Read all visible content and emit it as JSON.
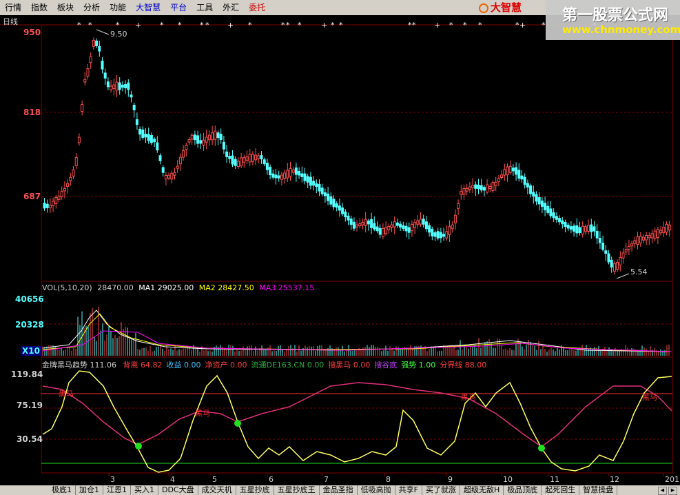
{
  "menu": {
    "items": [
      {
        "label": "行情",
        "color": "normal"
      },
      {
        "label": "指数",
        "color": "normal"
      },
      {
        "label": "板块",
        "color": "normal"
      },
      {
        "label": "分析",
        "color": "normal"
      },
      {
        "label": "功能",
        "color": "normal"
      },
      {
        "label": "大智慧",
        "color": "blue"
      },
      {
        "label": "平台",
        "color": "blue"
      },
      {
        "label": "工具",
        "color": "normal"
      },
      {
        "label": "外汇",
        "color": "normal"
      },
      {
        "label": "委托",
        "color": "red"
      }
    ],
    "logo": "大智慧"
  },
  "watermark": {
    "line1": "第一股票公式网",
    "line2": "www.chnmoney.com"
  },
  "chart": {
    "period": "日线",
    "price_axis": [
      "950",
      "818",
      "687"
    ],
    "high_label": "9.50",
    "low_label": "5.54",
    "vol_axis": [
      "40656",
      "20328"
    ],
    "vol_multiplier": "X10",
    "ind_axis": [
      "119.84",
      "75.19",
      "30.54"
    ],
    "month_labels": [
      "3",
      "4",
      "5",
      "6",
      "7",
      "8",
      "9",
      "10",
      "11",
      "12",
      "201"
    ]
  },
  "volume": {
    "name": "VOL",
    "params": "(5,10,20)",
    "value": "28470.00",
    "ma1_label": "MA1",
    "ma1": "29025.00",
    "ma2_label": "MA2",
    "ma2": "28427.50",
    "ma3_label": "MA3",
    "ma3": "25537.15"
  },
  "indicator": {
    "name": "金牌黑马趋势",
    "value": "111.06",
    "items": [
      {
        "label": "背离",
        "value": "64.82",
        "color": "#ff4040"
      },
      {
        "label": "收益",
        "value": "0.00",
        "color": "#40c0ff"
      },
      {
        "label": "净资产",
        "value": "0.00",
        "color": "#ff4040"
      },
      {
        "label": "流通DE163.CN",
        "value": "0.00",
        "color": "#20b040"
      },
      {
        "label": "搜黑马",
        "value": "0.00",
        "color": "#ff4040"
      },
      {
        "label": "搜谷底",
        "value": "",
        "color": "#c040ff"
      },
      {
        "label": "强势",
        "value": "1.00",
        "color": "#40ff40"
      },
      {
        "label": "分界线",
        "value": "88.00",
        "color": "#ff4040"
      }
    ],
    "horse_label": "黑马"
  },
  "tabs": [
    "极底1",
    "加仓1",
    "江恩1",
    "买入1",
    "DDC大盘",
    "成交天机",
    "五星抄底",
    "五星抄底王",
    "金品圣指",
    "低吸高抛",
    "共享F",
    "买了就涨",
    "超级无敌H",
    "极品顶底",
    "起死回生",
    "智慧操盘"
  ],
  "colors": {
    "up": "#ff5050",
    "down": "#54ffff",
    "grid": "#800000",
    "ma1": "#ffffff",
    "ma2": "#ffff00",
    "ma3": "#ff00ff",
    "yellow": "#ffff60",
    "pink": "#e0307a",
    "green": "#20e020"
  }
}
